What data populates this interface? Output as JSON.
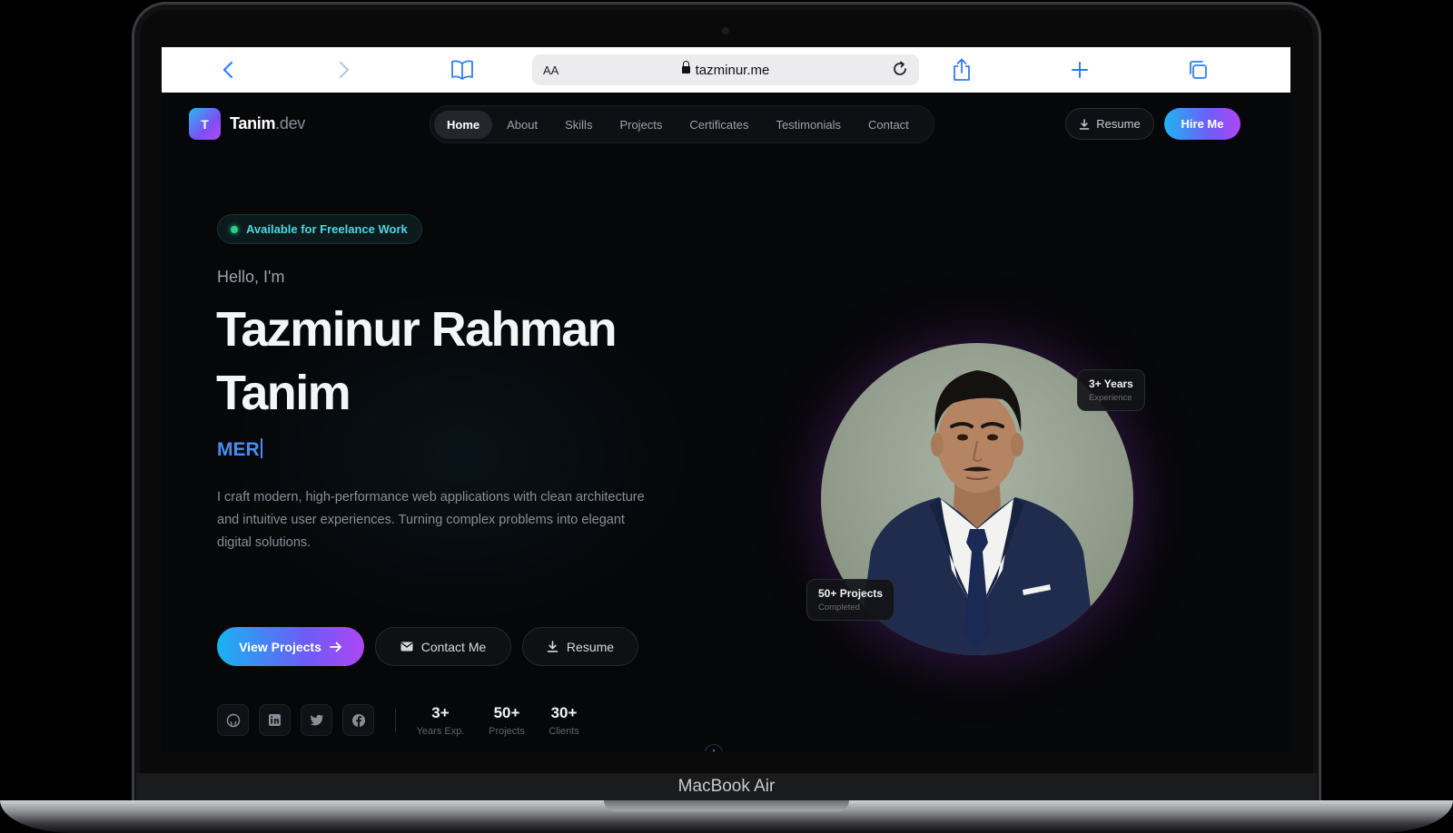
{
  "device": {
    "model_label": "MacBook Air"
  },
  "browser": {
    "aa_label": "AA",
    "url": "tazminur.me"
  },
  "site": {
    "logo": {
      "initial": "T",
      "name": "Tanim",
      "suffix": ".dev"
    },
    "nav": [
      {
        "label": "Home",
        "active": true
      },
      {
        "label": "About"
      },
      {
        "label": "Skills"
      },
      {
        "label": "Projects"
      },
      {
        "label": "Certificates"
      },
      {
        "label": "Testimonials"
      },
      {
        "label": "Contact"
      }
    ],
    "header_resume_label": "Resume",
    "hire_label": "Hire Me",
    "availability": "Available for Freelance Work",
    "greeting": "Hello, I'm",
    "name_line1": "Tazminur Rahman",
    "name_line2": "Tanim",
    "typed_text": "MER",
    "description": "I craft modern, high-performance web applications with clean architecture and intuitive user experiences. Turning complex problems into elegant digital solutions.",
    "buttons": {
      "view_projects": "View Projects",
      "contact_me": "Contact Me",
      "resume": "Resume"
    },
    "stats": [
      {
        "value": "3+",
        "label": "Years Exp."
      },
      {
        "value": "50+",
        "label": "Projects"
      },
      {
        "value": "30+",
        "label": "Clients"
      }
    ],
    "floating_badges": {
      "years": {
        "title": "3+ Years",
        "subtitle": "Experience"
      },
      "projects": {
        "title": "50+ Projects",
        "subtitle": "Completed"
      }
    },
    "social_icons": [
      "github-icon",
      "linkedin-icon",
      "twitter-icon",
      "facebook-icon"
    ],
    "colors": {
      "accent_start": "#18b3f2",
      "accent_mid": "#6c5cf6",
      "accent_end": "#ad47f3",
      "availability_dot": "#22d38a"
    }
  }
}
